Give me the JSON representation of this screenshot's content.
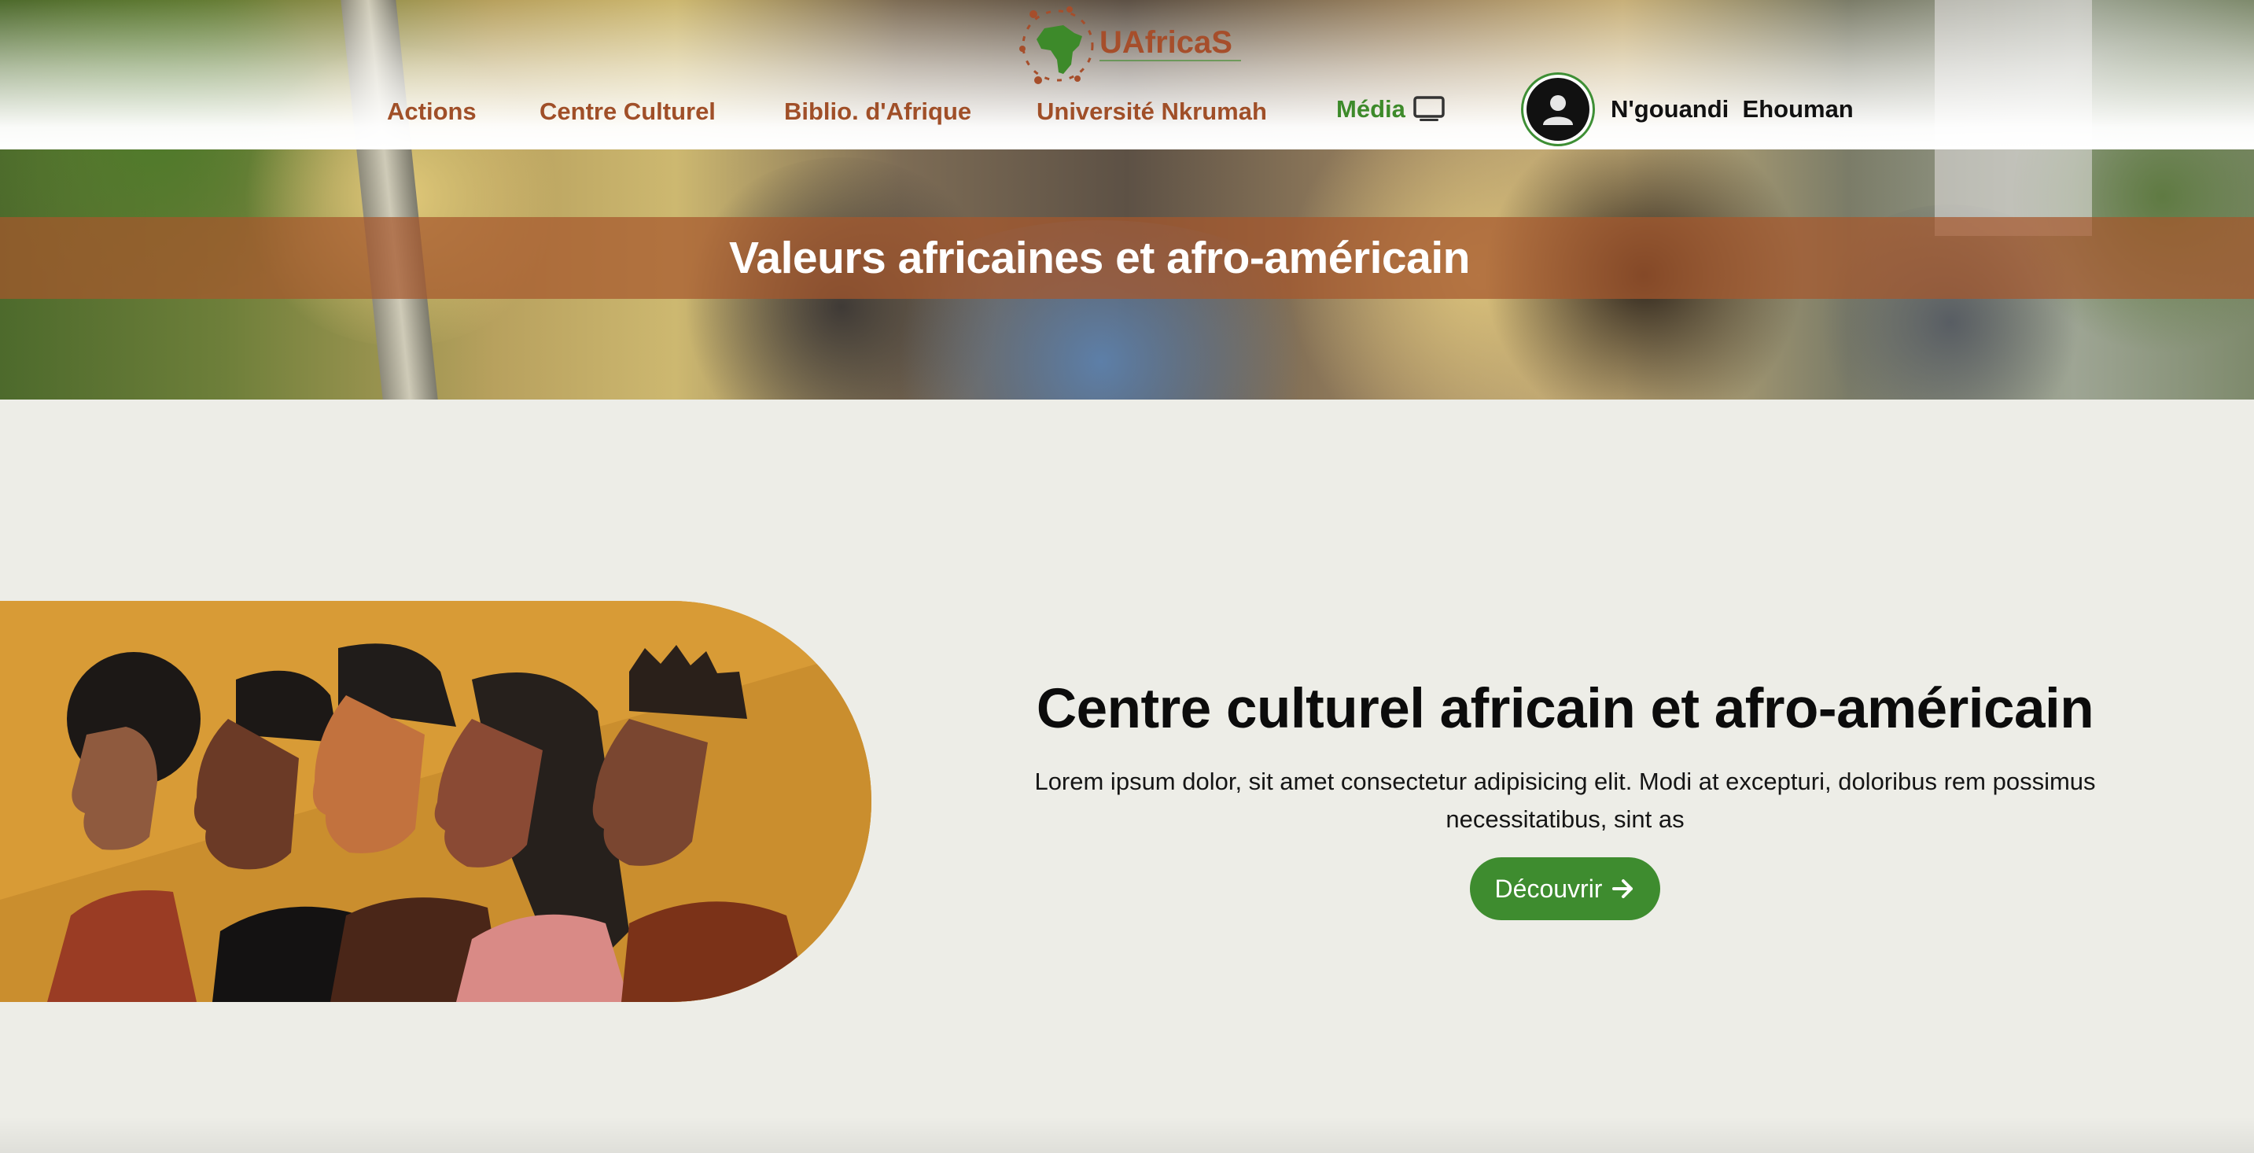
{
  "colors": {
    "accent_brown": "#a04f28",
    "accent_green": "#3e8c2f",
    "band_overlay": "#a6582c",
    "page_background": "#edede7"
  },
  "header": {
    "logo": {
      "brand": "UAfricaS",
      "icon": "africa-map-logo-icon"
    },
    "nav": [
      {
        "label": "Actions"
      },
      {
        "label": "Centre Culturel"
      },
      {
        "label": "Biblio. d'Afrique"
      },
      {
        "label": "Université Nkrumah"
      },
      {
        "label": "Média",
        "icon": "monitor-icon"
      }
    ],
    "user": {
      "avatar_icon": "user-icon",
      "name": "N'gouandi  Ehouman"
    }
  },
  "hero": {
    "title": "Valeurs africaines et afro-américain"
  },
  "section": {
    "illustration": "people-profiles-illustration",
    "title": "Centre culturel africain et afro-américain",
    "text": "Lorem ipsum dolor, sit amet consectetur adipisicing elit. Modi at excepturi, doloribus rem possimus necessitatibus, sint as",
    "button_label": "Découvrir",
    "button_icon": "arrow-right-icon"
  }
}
